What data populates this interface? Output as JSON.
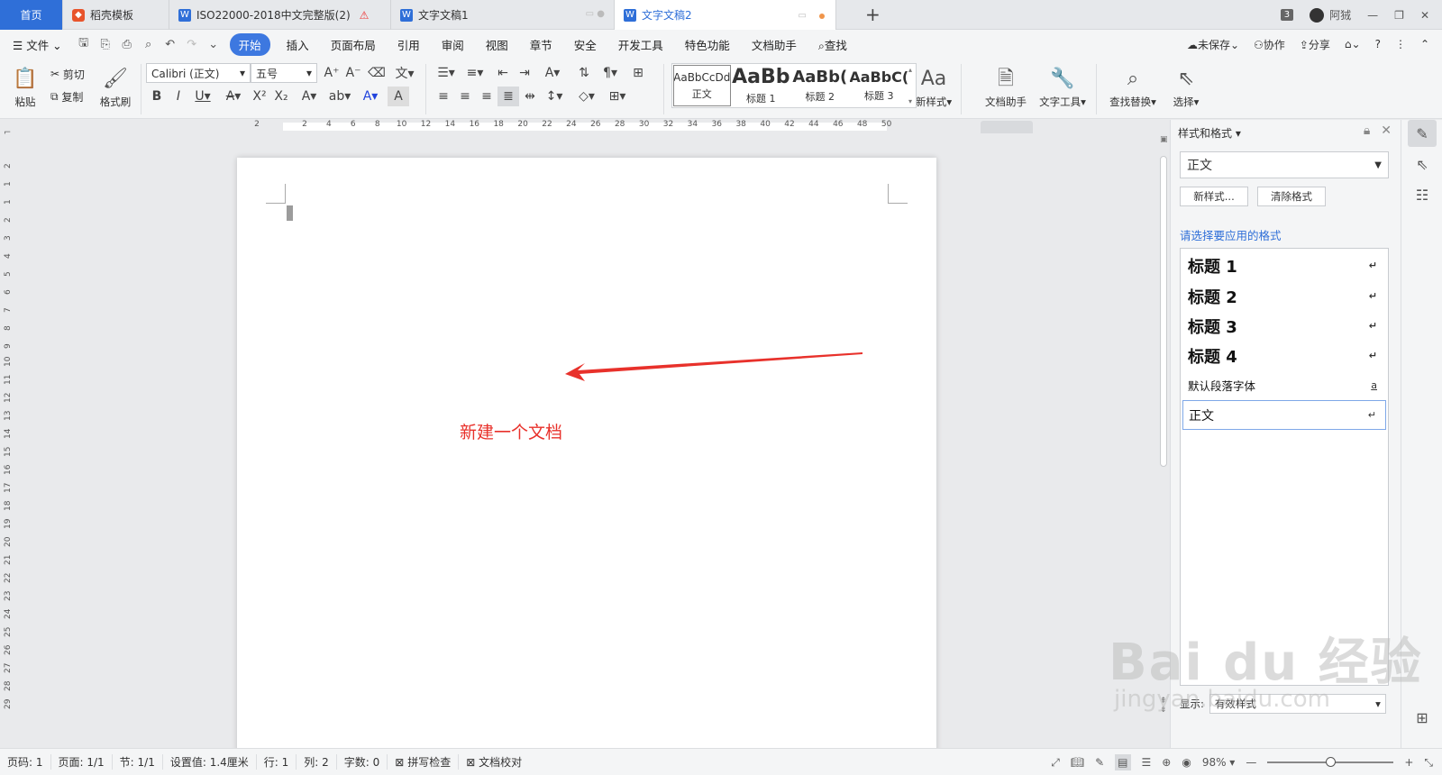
{
  "tabs": [
    {
      "label": "首页"
    },
    {
      "label": "稻壳模板"
    },
    {
      "label": "ISO22000-2018中文完整版(2)"
    },
    {
      "label": "文字文稿1"
    },
    {
      "label": "文字文稿2"
    }
  ],
  "window": {
    "badge": "3",
    "user": "阿狨"
  },
  "menu": {
    "file": "文件",
    "items": [
      "开始",
      "插入",
      "页面布局",
      "引用",
      "审阅",
      "视图",
      "章节",
      "安全",
      "开发工具",
      "特色功能",
      "文档助手"
    ],
    "search": "查找",
    "unsaved": "未保存",
    "collab": "协作",
    "share": "分享"
  },
  "ribbon": {
    "paste": "粘贴",
    "cut": "剪切",
    "copy": "复制",
    "format_painter": "格式刷",
    "font_name": "Calibri (正文)",
    "font_size": "五号",
    "styles": [
      {
        "preview": "AaBbCcDd",
        "label": "正文"
      },
      {
        "preview": "AaBb",
        "label": "标题 1"
      },
      {
        "preview": "AaBb(",
        "label": "标题 2"
      },
      {
        "preview": "AaBbC(",
        "label": "标题 3"
      }
    ],
    "new_style": "新样式",
    "doc_assistant": "文档助手",
    "text_tools": "文字工具",
    "find_replace": "查找替换",
    "select": "选择"
  },
  "ruler": {
    "h_ticks": [
      "2",
      "2",
      "4",
      "6",
      "8",
      "10",
      "12",
      "14",
      "16",
      "18",
      "20",
      "22",
      "24",
      "26",
      "28",
      "30",
      "32",
      "34",
      "36",
      "38",
      "40",
      "42",
      "44",
      "46",
      "48",
      "50"
    ],
    "v_ticks": [
      "2",
      "1",
      "1",
      "2",
      "3",
      "4",
      "5",
      "6",
      "7",
      "8",
      "9",
      "10",
      "11",
      "12",
      "13",
      "14",
      "15",
      "16",
      "17",
      "18",
      "19",
      "20",
      "21",
      "22",
      "23",
      "24",
      "25",
      "26",
      "27",
      "28",
      "29"
    ]
  },
  "document": {
    "annotation": "新建一个文档",
    "annotation_color": "#e8312b"
  },
  "panel": {
    "title": "样式和格式",
    "current_style": "正文",
    "new_style_btn": "新样式...",
    "clear_btn": "清除格式",
    "prompt": "请选择要应用的格式",
    "styles": [
      {
        "name": "标题  1",
        "mark": "↵"
      },
      {
        "name": "标题  2",
        "mark": "↵"
      },
      {
        "name": "标题  3",
        "mark": "↵"
      },
      {
        "name": "标题  4",
        "mark": "↵"
      },
      {
        "name": "默认段落字体",
        "mark": "a"
      },
      {
        "name": "正文",
        "mark": "↵"
      }
    ],
    "show_label": "显示:",
    "show_value": "有效样式"
  },
  "status": {
    "page_num": "页码: 1",
    "pages": "页面: 1/1",
    "section": "节: 1/1",
    "setting": "设置值: 1.4厘米",
    "row": "行: 1",
    "col": "列: 2",
    "words": "字数: 0",
    "spell": "拼写检查",
    "proof": "文档校对",
    "zoom": "98%"
  },
  "watermark": {
    "main": "Bai du 经验",
    "sub": "jingyan.baidu.com"
  }
}
